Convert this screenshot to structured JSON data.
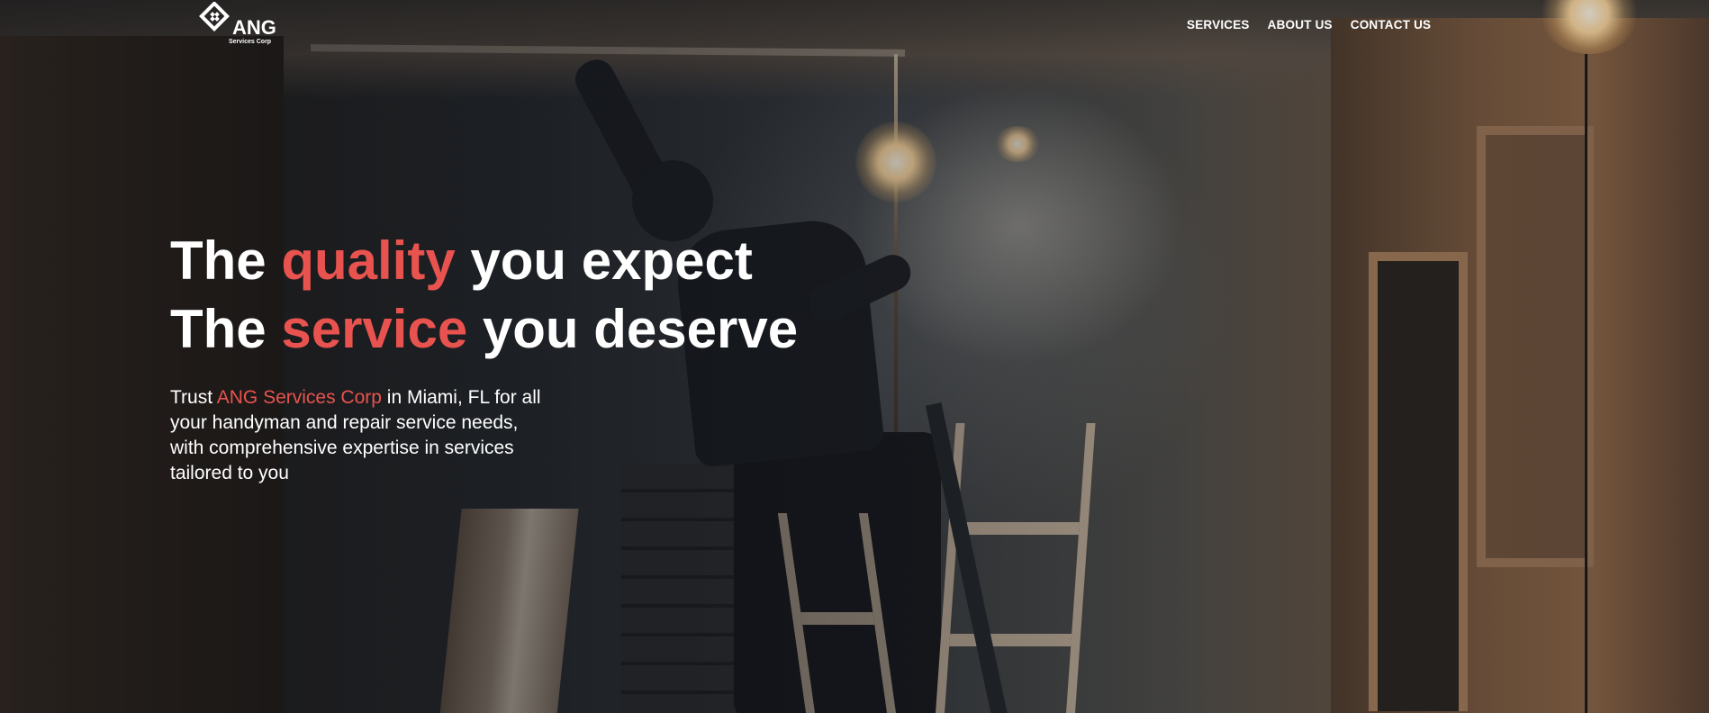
{
  "brand": {
    "name": "ANG",
    "tagline": "Services Corp"
  },
  "nav": {
    "items": [
      {
        "label": "SERVICES"
      },
      {
        "label": "ABOUT US"
      },
      {
        "label": "CONTACT US"
      }
    ]
  },
  "hero": {
    "line1": {
      "pre": "The ",
      "accent": "quality",
      "post": " you expect"
    },
    "line2": {
      "pre": "The ",
      "accent": "service",
      "post": " you deserve"
    },
    "sub": {
      "pre": "Trust ",
      "accent": "ANG Services Corp",
      "post": " in Miami, FL for all your handyman and repair service needs, with comprehensive expertise in services tailored to you"
    }
  },
  "colors": {
    "accent": "#e8534f",
    "text": "#ffffff"
  },
  "background_image": "photo of a construction worker on a ladder installing ceiling wiring in a dimly lit room under renovation"
}
